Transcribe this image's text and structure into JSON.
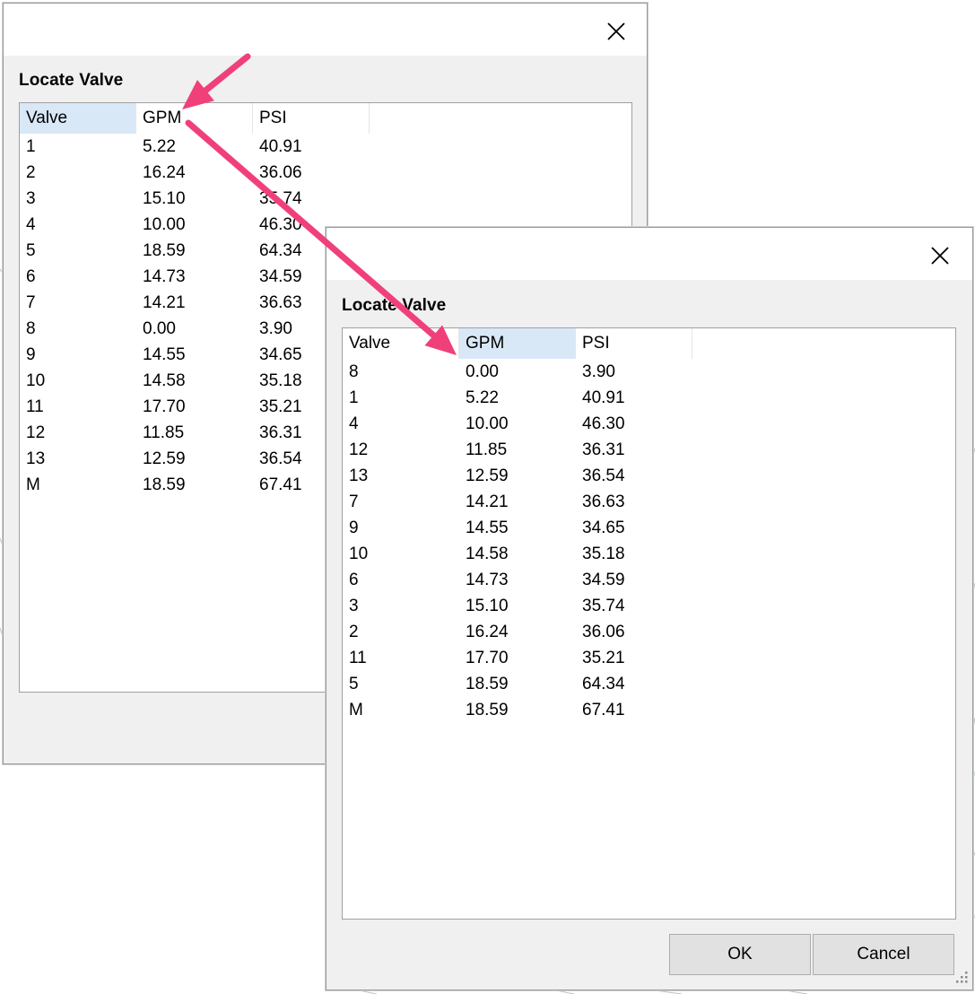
{
  "back_dialog": {
    "heading": "Locate Valve",
    "columns": [
      "Valve",
      "GPM",
      "PSI"
    ],
    "sorted_column": "Valve",
    "rows": [
      [
        "1",
        "5.22",
        "40.91"
      ],
      [
        "2",
        "16.24",
        "36.06"
      ],
      [
        "3",
        "15.10",
        "35.74"
      ],
      [
        "4",
        "10.00",
        "46.30"
      ],
      [
        "5",
        "18.59",
        "64.34"
      ],
      [
        "6",
        "14.73",
        "34.59"
      ],
      [
        "7",
        "14.21",
        "36.63"
      ],
      [
        "8",
        "0.00",
        "3.90"
      ],
      [
        "9",
        "14.55",
        "34.65"
      ],
      [
        "10",
        "14.58",
        "35.18"
      ],
      [
        "11",
        "17.70",
        "35.21"
      ],
      [
        "12",
        "11.85",
        "36.31"
      ],
      [
        "13",
        "12.59",
        "36.54"
      ],
      [
        "M",
        "18.59",
        "67.41"
      ]
    ]
  },
  "front_dialog": {
    "heading": "Locate Valve",
    "columns": [
      "Valve",
      "GPM",
      "PSI"
    ],
    "sorted_column": "GPM",
    "rows": [
      [
        "8",
        "0.00",
        "3.90"
      ],
      [
        "1",
        "5.22",
        "40.91"
      ],
      [
        "4",
        "10.00",
        "46.30"
      ],
      [
        "12",
        "11.85",
        "36.31"
      ],
      [
        "13",
        "12.59",
        "36.54"
      ],
      [
        "7",
        "14.21",
        "36.63"
      ],
      [
        "9",
        "14.55",
        "34.65"
      ],
      [
        "10",
        "14.58",
        "35.18"
      ],
      [
        "6",
        "14.73",
        "34.59"
      ],
      [
        "3",
        "15.10",
        "35.74"
      ],
      [
        "2",
        "16.24",
        "36.06"
      ],
      [
        "11",
        "17.70",
        "35.21"
      ],
      [
        "5",
        "18.59",
        "64.34"
      ],
      [
        "M",
        "18.59",
        "67.41"
      ]
    ],
    "ok_label": "OK",
    "cancel_label": "Cancel"
  },
  "colors": {
    "arrow": "#f0407a",
    "sorted_header": "#d9e8f7",
    "dialog_bg": "#f0f0f0"
  },
  "icons": {
    "close": "close-icon",
    "grip": "resize-grip-icon"
  }
}
